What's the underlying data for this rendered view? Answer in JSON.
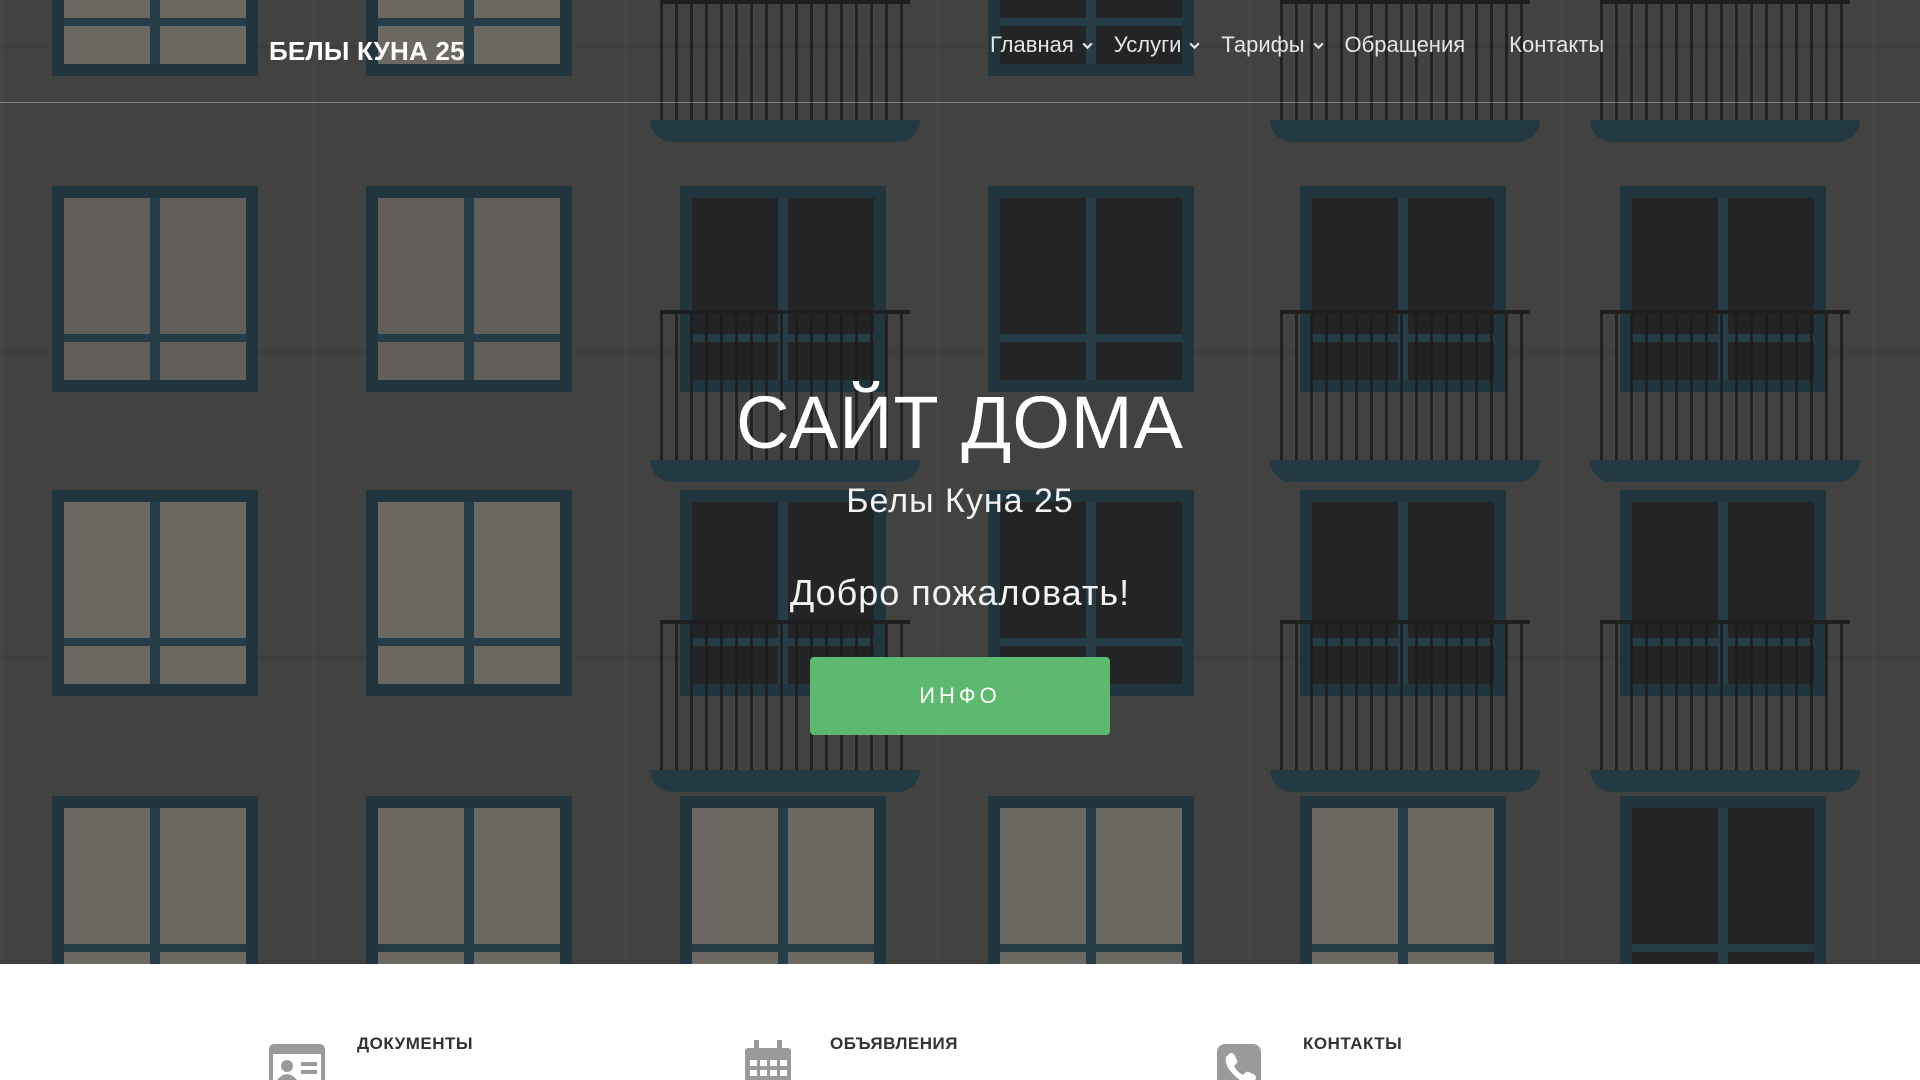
{
  "nav": {
    "brand": "БЕЛЫ КУНА 25",
    "items": [
      {
        "label": "Главная",
        "dropdown": true
      },
      {
        "label": "Услуги",
        "dropdown": true
      },
      {
        "label": "Тарифы",
        "dropdown": true
      },
      {
        "label": "Обращения",
        "dropdown": false
      },
      {
        "label": "Контакты",
        "dropdown": false
      }
    ]
  },
  "hero": {
    "title": "САЙТ ДОМА",
    "subtitle": "Белы Куна 25",
    "welcome": "Добро пожаловать!",
    "button_label": "ИНФО"
  },
  "features": [
    {
      "label": "ДОКУМЕНТЫ",
      "icon": "id-card-icon"
    },
    {
      "label": "ОБЪЯВЛЕНИЯ",
      "icon": "calendar-icon"
    },
    {
      "label": "КОНТАКТЫ",
      "icon": "phone-icon"
    }
  ],
  "colors": {
    "accent_button": "#5cb96e",
    "hero_overlay": "#232323",
    "feature_icon": "#9a9a9a",
    "feature_text": "#333333"
  }
}
